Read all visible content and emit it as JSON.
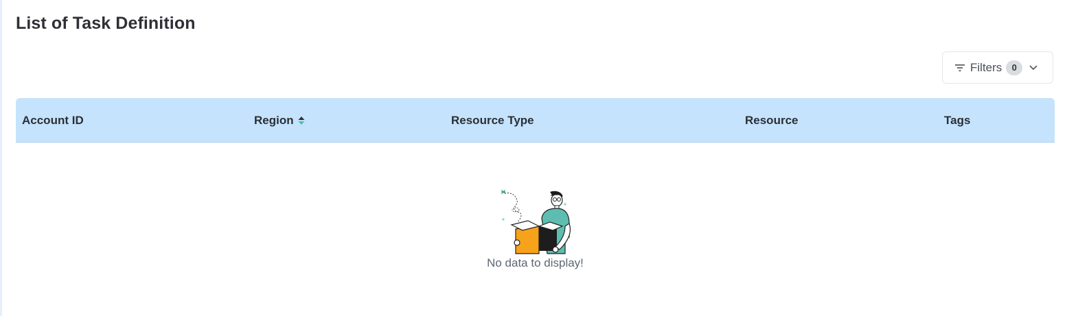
{
  "page": {
    "title": "List of Task Definition"
  },
  "filters": {
    "label": "Filters",
    "count": "0"
  },
  "table": {
    "columns": [
      "Account ID",
      "Region",
      "Resource Type",
      "Resource",
      "Tags"
    ],
    "rows": []
  },
  "empty_state": {
    "message": "No data to display!"
  },
  "colors": {
    "header_bg": "#c5e3fc",
    "box_orange": "#f7a21b",
    "shirt_teal": "#5dbdb0"
  }
}
